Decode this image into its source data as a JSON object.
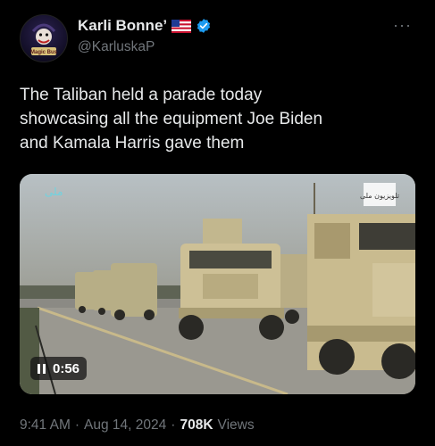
{
  "author": {
    "display_name": "Karli Bonne’",
    "handle": "@KarluskaP",
    "avatar_text": "Magic Bus",
    "flag_icon": "us-flag-icon",
    "verified_icon": "verified-badge-icon",
    "verified_color": "#1d9bf0"
  },
  "menu": {
    "more_label": "···"
  },
  "tweet": {
    "lines": [
      "The Taliban held a parade today",
      "showcasing all the equipment Joe Biden",
      "and Kamala Harris gave them"
    ]
  },
  "media": {
    "type": "video",
    "state": "paused",
    "duration": "0:56",
    "watermark": "تلویزیون ملی",
    "channel_logo": "ملی"
  },
  "meta": {
    "time": "9:41 AM",
    "date": "Aug 14, 2024",
    "separator": "·",
    "views_count": "708K",
    "views_label": "Views"
  }
}
